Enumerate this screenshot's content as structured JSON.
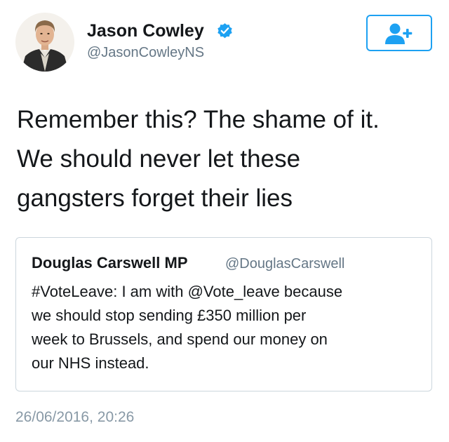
{
  "tweet": {
    "author": {
      "display_name": "Jason Cowley",
      "handle": "@JasonCowleyNS",
      "verified": true
    },
    "text": "Remember this? The shame of it.\nWe should never let these\ngangsters forget their lies",
    "timestamp": "26/06/2016, 20:26"
  },
  "quoted_tweet": {
    "display_name": "Douglas Carswell MP",
    "handle": "@DouglasCarswell",
    "text": "#VoteLeave: I am with @Vote_leave because\nwe should stop sending £350 million per\nweek to Brussels, and spend our money on\nour NHS instead."
  },
  "actions": {
    "follow_icon": "add-user-icon"
  },
  "colors": {
    "accent": "#1da1f2",
    "secondary_text": "#657786",
    "timestamp_text": "#8899a6",
    "border": "#ccd6dd"
  }
}
